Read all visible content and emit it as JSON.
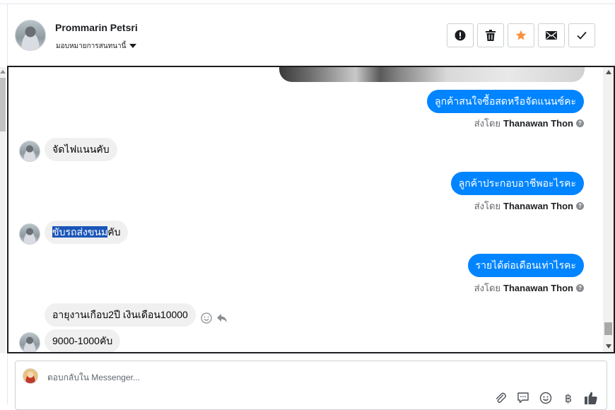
{
  "header": {
    "name": "Prommarin Petsri",
    "assign_label": "มอบหมายการสนทนานี้"
  },
  "messages": {
    "out1": "ลูกค้าสนใจซื้อสดหรือจัดแนนซ์คะ",
    "in1": "จัดไฟแนนคับ",
    "out2": "ลูกค้าประกอบอาชีพอะไรคะ",
    "in2_selected": "ขับรถส่งขนม",
    "in2_rest": "คับ",
    "out3": "รายได้ต่อเดือนเท่าไรคะ",
    "in3": "อายุงานเกือบ2ปี เงินเดือน10000",
    "in4": "9000-1000คับ"
  },
  "sent_by": {
    "prefix": "ส่งโดย",
    "agent": "Thanawan Thon"
  },
  "composer": {
    "placeholder": "ตอบกลับใน Messenger..."
  },
  "colors": {
    "accent": "#0084ff",
    "star": "#f7923b",
    "selection": "#1a55b8"
  },
  "icons": [
    "alert-icon",
    "trash-icon",
    "star-icon",
    "envelope-icon",
    "check-icon",
    "smiley-icon",
    "reply-icon",
    "paperclip-icon",
    "chat-icon",
    "emoji-icon",
    "baht-icon",
    "thumbs-up-icon"
  ]
}
